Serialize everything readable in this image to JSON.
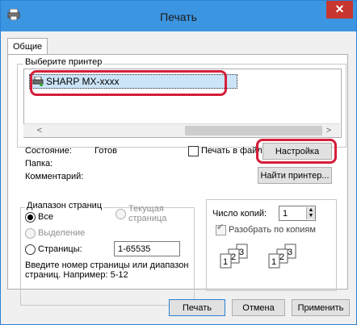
{
  "window": {
    "title": "Печать",
    "close_label": "✕"
  },
  "tabs": [
    {
      "label": "Общие"
    }
  ],
  "printer_group": {
    "label": "Выберите принтер",
    "selected_printer": "SHARP MX-xxxx",
    "scroll_left": "<",
    "scroll_right": ">"
  },
  "status": {
    "state_label": "Состояние:",
    "state_value": "Готов",
    "folder_label": "Папка:",
    "comment_label": "Комментарий:",
    "print_to_file_label": "Печать в файл",
    "settings_button": "Настройка",
    "find_printer_button": "Найти принтер..."
  },
  "page_range": {
    "label": "Диапазон страниц",
    "all_label": "Все",
    "current_page_label": "Текущая страница",
    "selection_label": "Выделение",
    "pages_label": "Страницы:",
    "pages_value": "1-65535",
    "hint": "Введите номер страницы или диапазон страниц.  Например: 5-12"
  },
  "copies": {
    "label": "Число копий:",
    "value": "1",
    "collate_label": "Разобрать по копиям"
  },
  "footer": {
    "print_button": "Печать",
    "cancel_button": "Отмена",
    "apply_button": "Применить"
  },
  "colors": {
    "titlebar": "#3c95e1",
    "highlight_frame": "#d51e3a",
    "selection": "#cce4f7",
    "close": "#c7372f"
  }
}
